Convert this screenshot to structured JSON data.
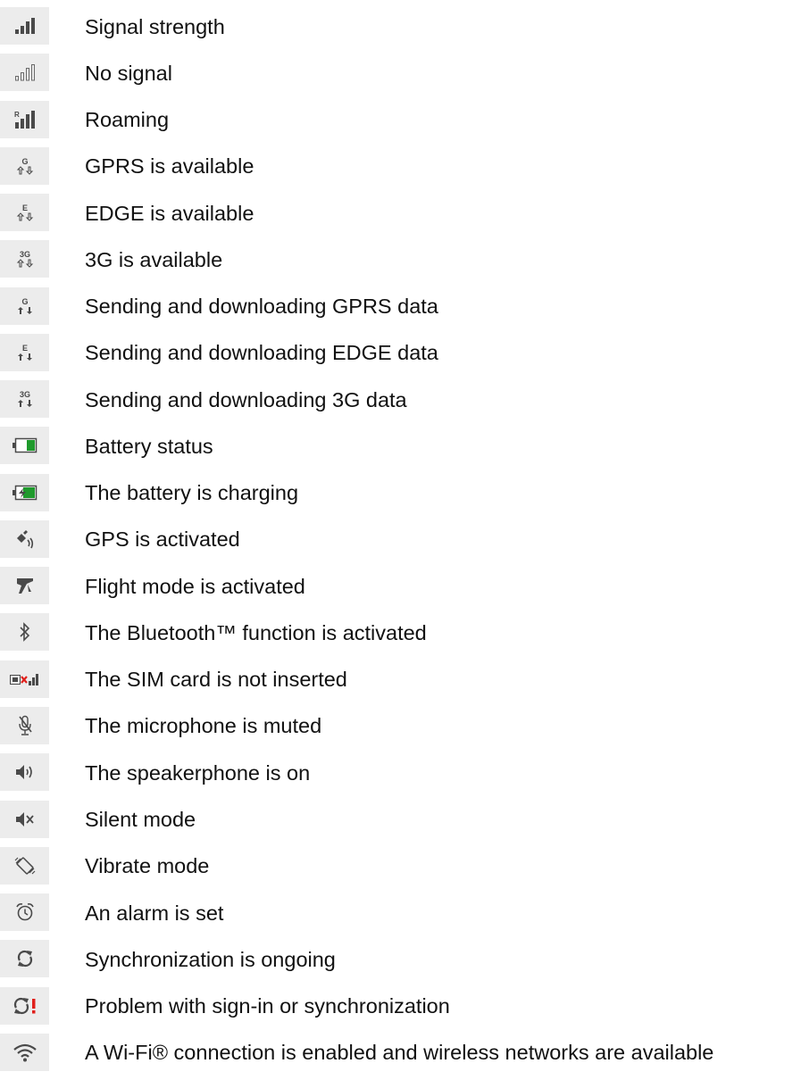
{
  "rows": [
    {
      "icon": "signal-strength-icon",
      "label": "Signal strength"
    },
    {
      "icon": "no-signal-icon",
      "label": "No signal"
    },
    {
      "icon": "roaming-icon",
      "label": "Roaming",
      "glyph": "R"
    },
    {
      "icon": "gprs-available-icon",
      "label": "GPRS is available",
      "glyph": "G"
    },
    {
      "icon": "edge-available-icon",
      "label": "EDGE is available",
      "glyph": "E"
    },
    {
      "icon": "3g-available-icon",
      "label": "3G is available",
      "glyph": "3G"
    },
    {
      "icon": "gprs-data-transfer-icon",
      "label": "Sending and downloading GPRS data",
      "glyph": "G"
    },
    {
      "icon": "edge-data-transfer-icon",
      "label": "Sending and downloading EDGE data",
      "glyph": "E"
    },
    {
      "icon": "3g-data-transfer-icon",
      "label": "Sending and downloading 3G data",
      "glyph": "3G"
    },
    {
      "icon": "battery-status-icon",
      "label": "Battery status"
    },
    {
      "icon": "battery-charging-icon",
      "label": "The battery is charging"
    },
    {
      "icon": "gps-icon",
      "label": "GPS is activated"
    },
    {
      "icon": "flight-mode-icon",
      "label": "Flight mode is activated"
    },
    {
      "icon": "bluetooth-icon",
      "label": "The Bluetooth™ function is activated"
    },
    {
      "icon": "no-sim-icon",
      "label": "The SIM card is not inserted"
    },
    {
      "icon": "microphone-muted-icon",
      "label": "The microphone is muted"
    },
    {
      "icon": "speakerphone-icon",
      "label": "The speakerphone is on"
    },
    {
      "icon": "silent-mode-icon",
      "label": "Silent mode"
    },
    {
      "icon": "vibrate-mode-icon",
      "label": "Vibrate mode"
    },
    {
      "icon": "alarm-icon",
      "label": "An alarm is set"
    },
    {
      "icon": "sync-icon",
      "label": "Synchronization is ongoing"
    },
    {
      "icon": "sync-problem-icon",
      "label": "Problem with sign-in or synchronization"
    },
    {
      "icon": "wifi-icon",
      "label": "A Wi-Fi® connection is enabled and wireless networks are available"
    }
  ],
  "colors": {
    "icon_background": "#ececec",
    "icon_foreground": "#4a4a4a",
    "battery_green": "#1f9a2c",
    "alert_red": "#e0201b",
    "text": "#111111"
  }
}
